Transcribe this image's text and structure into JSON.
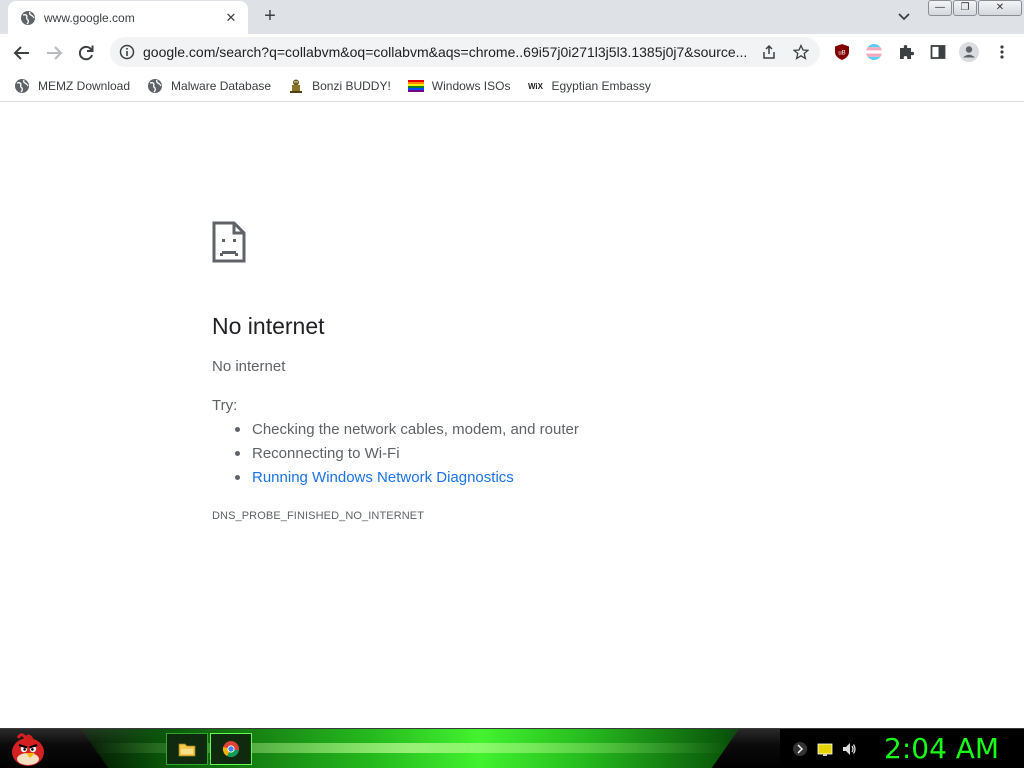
{
  "browser": {
    "tab": {
      "title": "www.google.com",
      "favicon": "globe-icon"
    },
    "new_tab_label": "+",
    "window_controls": {
      "minimize": "—",
      "restore": "❐",
      "close": "✕"
    },
    "url": "google.com/search?q=collabvm&oq=collabvm&aqs=chrome..69i57j0i271l3j5l3.1385j0j7&source...",
    "bookmarks": [
      {
        "label": "MEMZ Download",
        "icon": "globe-icon"
      },
      {
        "label": "Malware Database",
        "icon": "globe-icon"
      },
      {
        "label": "Bonzi BUDDY!",
        "icon": "bonzi-icon"
      },
      {
        "label": "Windows ISOs",
        "icon": "rainbow-flag-icon"
      },
      {
        "label": "Egyptian Embassy",
        "icon": "wix-icon",
        "icon_text": "WiX"
      }
    ],
    "extensions": [
      "ublock-icon",
      "trans-flag-icon",
      "puzzle-icon",
      "side-panel-icon",
      "profile-icon",
      "more-icon"
    ],
    "ublock_text": "uB"
  },
  "error_page": {
    "title": "No internet",
    "subtitle": "No internet",
    "try_label": "Try:",
    "suggestions": [
      {
        "text": "Checking the network cables, modem, and router",
        "link": false
      },
      {
        "text": "Reconnecting to Wi-Fi",
        "link": false
      },
      {
        "text": "Running Windows Network Diagnostics",
        "link": true
      }
    ],
    "error_code": "DNS_PROBE_FINISHED_NO_INTERNET"
  },
  "taskbar": {
    "clock": "2:04 AM",
    "apps": [
      "explorer-icon",
      "chrome-icon"
    ],
    "tray": [
      "network-icon",
      "battery-icon",
      "volume-icon"
    ]
  },
  "colors": {
    "link": "#1a73e8",
    "clock": "#19ff19",
    "taskbar_glow": "#45ff30"
  }
}
